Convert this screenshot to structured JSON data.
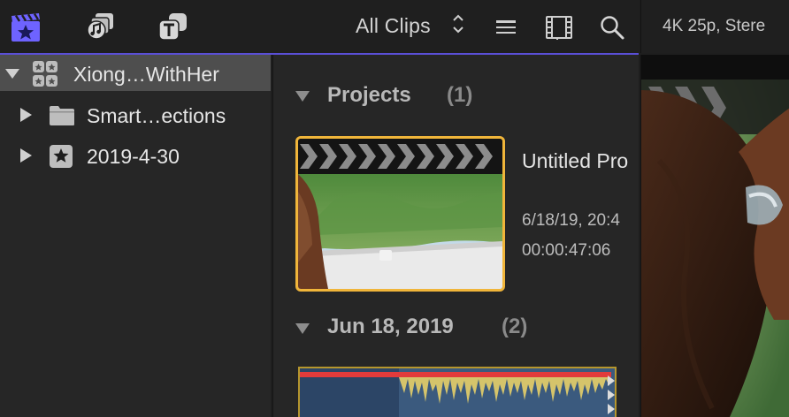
{
  "toolbar": {
    "clips_filter_label": "All Clips",
    "icons": [
      "libraries-icon",
      "photos-audio-icon",
      "titles-generators-icon",
      "list-view-icon",
      "filmstrip-view-icon",
      "search-icon"
    ]
  },
  "viewer": {
    "format_label": "4K 25p, Stere"
  },
  "sidebar": {
    "items": [
      {
        "label": "Xiong…WithHer",
        "icon": "library-icon",
        "expanded": true,
        "selected": true
      },
      {
        "label": "Smart…ections",
        "icon": "folder-icon",
        "expanded": false,
        "selected": false
      },
      {
        "label": "2019-4-30",
        "icon": "event-star-icon",
        "expanded": false,
        "selected": false
      }
    ]
  },
  "browser": {
    "sections": [
      {
        "title": "Projects",
        "count": "(1)"
      },
      {
        "title": "Jun 18, 2019",
        "count": "(2)"
      }
    ],
    "project": {
      "name": "Untitled Pro",
      "date": "6/18/19, 20:4",
      "duration": "00:00:47:06"
    }
  },
  "colors": {
    "accent": "#5a4fd6",
    "selection_outline": "#f0b53a",
    "clip_red_bar": "#e23b3b"
  }
}
